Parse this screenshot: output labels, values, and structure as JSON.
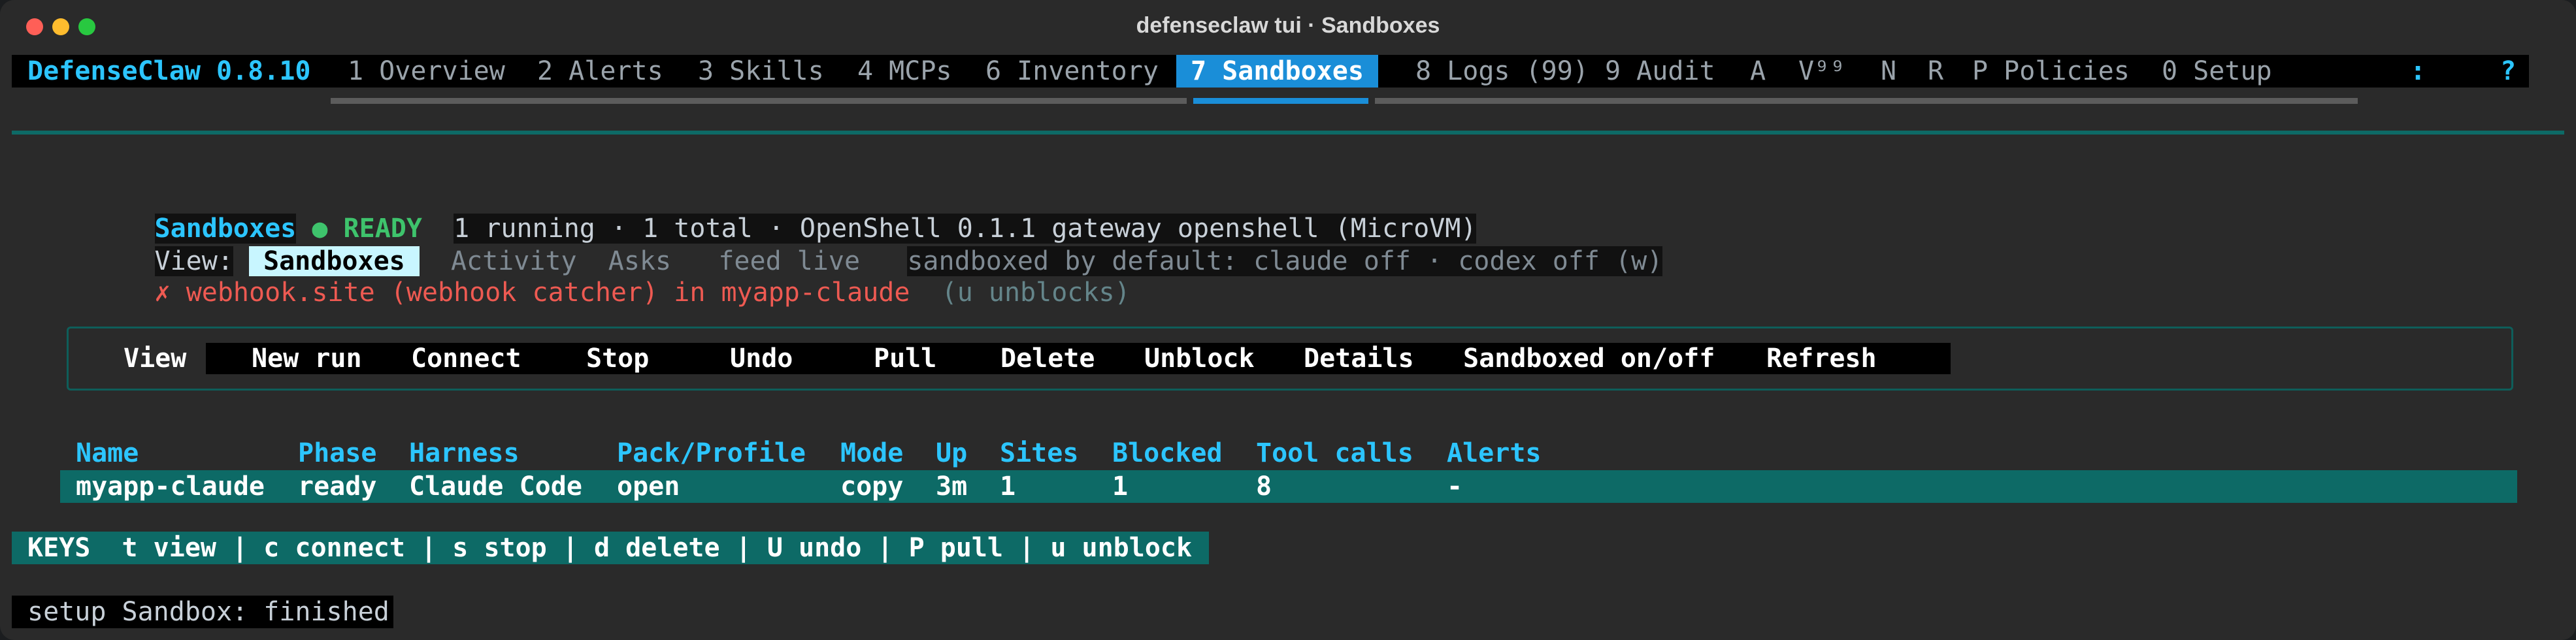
{
  "window": {
    "title": "defenseclaw tui · Sandboxes"
  },
  "nav": {
    "brand": "DefenseClaw 0.8.10",
    "tabs": [
      {
        "label": "1 Overview"
      },
      {
        "label": "2 Alerts"
      },
      {
        "label": "3 Skills"
      },
      {
        "label": "4 MCPs"
      },
      {
        "label": "6 Inventory"
      },
      {
        "label": "7 Sandboxes",
        "active": true
      },
      {
        "label": "8 Logs (99)"
      },
      {
        "label": "9 Audit"
      },
      {
        "label": "A"
      },
      {
        "label": "V⁹⁹"
      },
      {
        "label": "N"
      },
      {
        "label": "R"
      },
      {
        "label": "P Policies"
      },
      {
        "label": "0 Setup"
      }
    ],
    "colon": ":",
    "help": "?"
  },
  "header": {
    "title": "Sandboxes",
    "status_dot": "●",
    "status": "READY",
    "summary": "1 running · 1 total · OpenShell 0.1.1 gateway openshell (MicroVM)"
  },
  "view": {
    "label": "View:",
    "tabs": [
      "Sandboxes",
      "Activity",
      "Asks"
    ],
    "active_tab": "Sandboxes",
    "feed": "feed live",
    "sandboxed_default": "sandboxed by default: claude off · codex off (w)"
  },
  "alert": {
    "icon": "✗",
    "text": "webhook.site (webhook catcher) in myapp-claude",
    "hint": "(u unblocks)"
  },
  "actions": {
    "view": "View",
    "new_run": "New run",
    "connect": "Connect",
    "stop": "Stop",
    "undo": "Undo",
    "pull": "Pull",
    "delete": "Delete",
    "unblock": "Unblock",
    "details": "Details",
    "sandboxed_toggle": "Sandboxed on/off",
    "refresh": "Refresh"
  },
  "table": {
    "columns": [
      "Name",
      "Phase",
      "Harness",
      "Pack/Profile",
      "Mode",
      "Up",
      "Sites",
      "Blocked",
      "Tool calls",
      "Alerts"
    ],
    "rows": [
      [
        "myapp-claude",
        "ready",
        "Claude Code",
        "open",
        "copy",
        "3m",
        "1",
        "1",
        "8",
        "-"
      ]
    ]
  },
  "keys": {
    "text": "KEYS  t view | c connect | s stop | d delete | U undo | P pull | u unblock"
  },
  "status": {
    "text": "setup Sandbox: finished"
  },
  "colors": {
    "accent": "#2cc5ff",
    "active_tab": "#1a8ed8",
    "ready": "#3ec36c",
    "alert": "#ee5a52",
    "selection": "#0d6a66"
  }
}
